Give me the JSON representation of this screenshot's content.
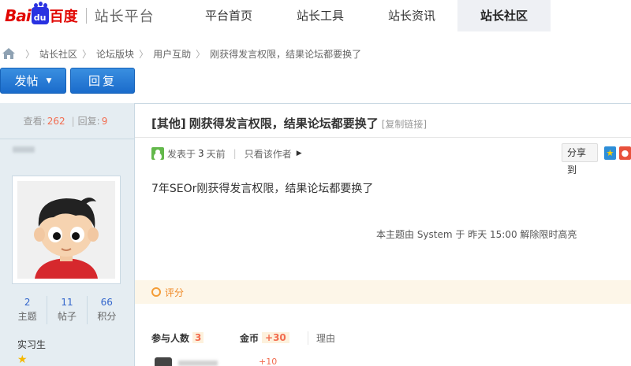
{
  "brand": {
    "logo_part1": "Bai",
    "logo_paw": "du",
    "logo_cn": "百度",
    "subtitle": "站长平台"
  },
  "nav": {
    "items": [
      {
        "label": "平台首页"
      },
      {
        "label": "站长工具"
      },
      {
        "label": "站长资讯"
      },
      {
        "label": "站长社区"
      }
    ],
    "active": "站长社区"
  },
  "breadcrumb": [
    "站长社区",
    "论坛版块",
    "用户互助",
    "刚获得发言权限，结果论坛都要换了"
  ],
  "actions": {
    "post_label": "发帖",
    "reply_label": "回复"
  },
  "thread_stats": {
    "views_label": "查看:",
    "views": "262",
    "replies_label": "回复:",
    "replies": "9"
  },
  "author": {
    "stats": [
      {
        "value": "2",
        "label": "主题"
      },
      {
        "value": "11",
        "label": "帖子"
      },
      {
        "value": "66",
        "label": "积分"
      }
    ],
    "rank": "实习生"
  },
  "post": {
    "category": "[其他]",
    "title": "刚获得发言权限，结果论坛都要换了",
    "copy_link": "[复制链接]",
    "posted_prefix": "发表于",
    "posted_num": "3",
    "posted_suffix": "天前",
    "only_author": "只看该作者",
    "share_label": "分享到",
    "body": "7年SEOr刚获得发言权限，结果论坛都要换了",
    "system_note": "本主题由 System 于 昨天 15:00 解除限时高亮"
  },
  "rating": {
    "section_label": "评分",
    "participants_label": "参与人数",
    "participants": "3",
    "coin_label": "金币",
    "coin_total": "+30",
    "reason_label": "理由",
    "first_row_value": "+10"
  },
  "colors": {
    "accent_blue": "#1a6bcb",
    "highlight_orange": "#f26c4f",
    "sidebar_bg": "#e5edf2"
  }
}
